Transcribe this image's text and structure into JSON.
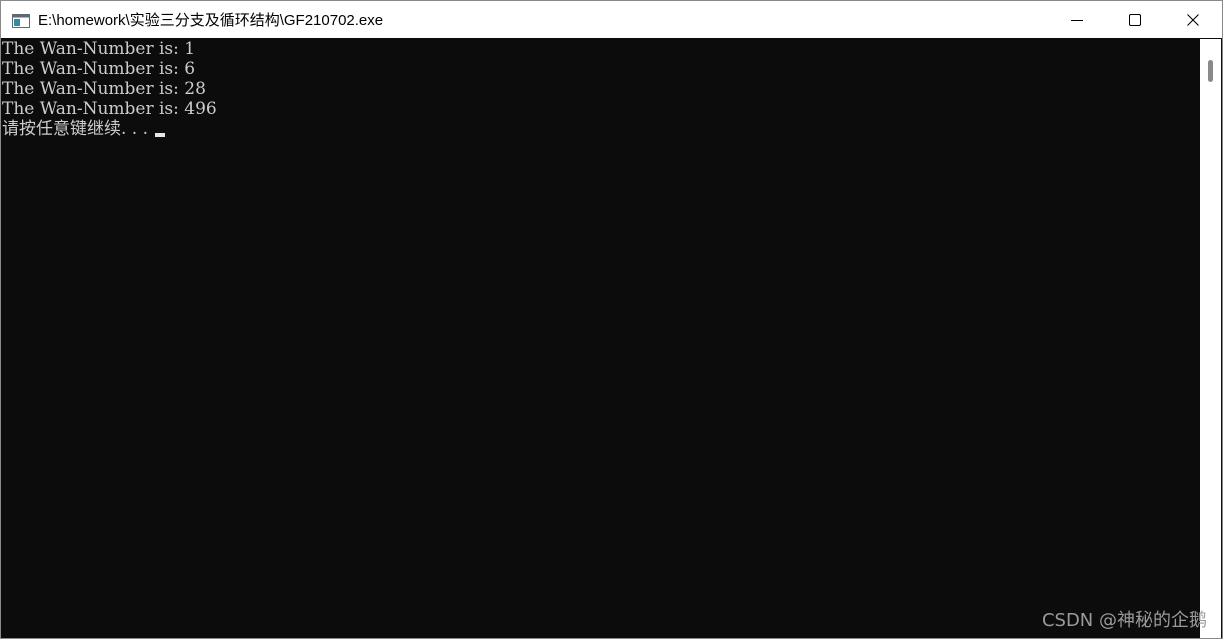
{
  "window": {
    "title": "E:\\homework\\实验三分支及循环结构\\GF210702.exe",
    "icon": "console-app-icon"
  },
  "controls": {
    "minimize_icon": "minimize-icon",
    "maximize_icon": "maximize-icon",
    "close_icon": "close-icon"
  },
  "console": {
    "lines": [
      "The Wan-Number is: 1",
      "The Wan-Number is: 6",
      "The Wan-Number is: 28",
      "The Wan-Number is: 496",
      "请按任意键继续. . . "
    ],
    "text_color": "#cccccc",
    "background": "#0c0c0c"
  },
  "watermark": {
    "text": "CSDN @神秘的企鹅"
  }
}
